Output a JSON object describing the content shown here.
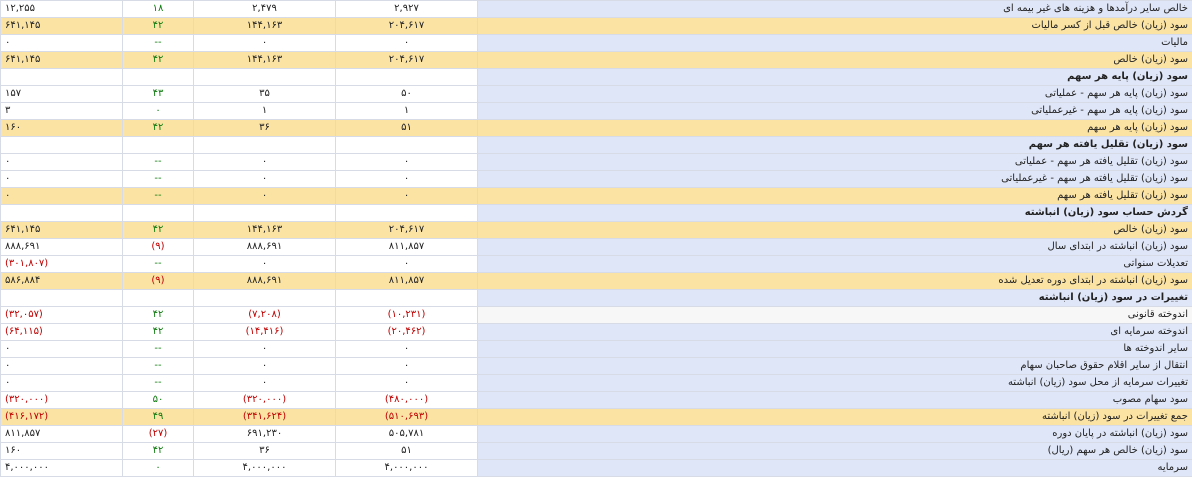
{
  "rows": [
    {
      "label": "خالص سایر درآمدها و هزینه های غیر بیمه ای",
      "v1": "۲,۹۲۷",
      "v2": "۲,۴۷۹",
      "v3": "۱۸",
      "v3c": "pos",
      "v4": "۱۲,۲۵۵",
      "style": ""
    },
    {
      "label": "سود (زیان) خالص قبل از کسر مالیات",
      "v1": "۲۰۴,۶۱۷",
      "v2": "۱۴۴,۱۶۳",
      "v3": "۴۲",
      "v3c": "pos",
      "v4": "۶۴۱,۱۴۵",
      "style": "gold"
    },
    {
      "label": "مالیات",
      "v1": "۰",
      "v2": "۰",
      "v3": "--",
      "v3c": "pos",
      "v4": "۰",
      "style": ""
    },
    {
      "label": "سود (زیان) خالص",
      "v1": "۲۰۴,۶۱۷",
      "v2": "۱۴۴,۱۶۳",
      "v3": "۴۲",
      "v3c": "pos",
      "v4": "۶۴۱,۱۴۵",
      "style": "gold"
    },
    {
      "label": "سود (زیان) پایه هر سهم",
      "v1": "",
      "v2": "",
      "v3": "",
      "v3c": "",
      "v4": "",
      "style": "header"
    },
    {
      "label": "سود (زیان) پایه هر سهم - عملیاتی",
      "v1": "۵۰",
      "v2": "۳۵",
      "v3": "۴۳",
      "v3c": "pos",
      "v4": "۱۵۷",
      "style": ""
    },
    {
      "label": "سود (زیان) پایه هر سهم - غیرعملیاتی",
      "v1": "۱",
      "v2": "۱",
      "v3": "۰",
      "v3c": "pos",
      "v4": "۳",
      "style": ""
    },
    {
      "label": "سود (زیان) پایه هر سهم",
      "v1": "۵۱",
      "v2": "۳۶",
      "v3": "۴۲",
      "v3c": "pos",
      "v4": "۱۶۰",
      "style": "gold"
    },
    {
      "label": "سود (زیان) تقلیل یافته هر سهم",
      "v1": "",
      "v2": "",
      "v3": "",
      "v3c": "",
      "v4": "",
      "style": "header"
    },
    {
      "label": "سود (زیان) تقلیل یافته هر سهم - عملیاتی",
      "v1": "۰",
      "v2": "۰",
      "v3": "--",
      "v3c": "pos",
      "v4": "۰",
      "style": ""
    },
    {
      "label": "سود (زیان) تقلیل یافته هر سهم - غیرعملیاتی",
      "v1": "۰",
      "v2": "۰",
      "v3": "--",
      "v3c": "pos",
      "v4": "۰",
      "style": ""
    },
    {
      "label": "سود (زیان) تقلیل یافته هر سهم",
      "v1": "۰",
      "v2": "۰",
      "v3": "--",
      "v3c": "pos",
      "v4": "۰",
      "style": "gold"
    },
    {
      "label": "گردش حساب سود (زیان) انباشته",
      "v1": "",
      "v2": "",
      "v3": "",
      "v3c": "",
      "v4": "",
      "style": "header"
    },
    {
      "label": "سود (زیان) خالص",
      "v1": "۲۰۴,۶۱۷",
      "v2": "۱۴۴,۱۶۳",
      "v3": "۴۲",
      "v3c": "pos",
      "v4": "۶۴۱,۱۴۵",
      "style": "gold"
    },
    {
      "label": "سود (زیان) انباشته در ابتدای سال",
      "v1": "۸۱۱,۸۵۷",
      "v2": "۸۸۸,۶۹۱",
      "v3": "(۹)",
      "v3c": "neg",
      "v4": "۸۸۸,۶۹۱",
      "style": ""
    },
    {
      "label": "تعدیلات سنواتی",
      "v1": "۰",
      "v2": "۰",
      "v3": "--",
      "v3c": "pos",
      "v4": "(۳۰۱,۸۰۷)",
      "v4c": "neg",
      "style": ""
    },
    {
      "label": "سود (زیان) انباشته در ابتدای دوره تعدیل شده",
      "v1": "۸۱۱,۸۵۷",
      "v2": "۸۸۸,۶۹۱",
      "v3": "(۹)",
      "v3c": "neg",
      "v4": "۵۸۶,۸۸۴",
      "style": "gold"
    },
    {
      "label": "تغییرات در سود (زیان) انباشته",
      "v1": "",
      "v2": "",
      "v3": "",
      "v3c": "",
      "v4": "",
      "style": "header"
    },
    {
      "label": "اندوخته قانونی",
      "v1": "(۱۰,۲۳۱)",
      "v1c": "neg",
      "v2": "(۷,۲۰۸)",
      "v2c": "neg",
      "v3": "۴۲",
      "v3c": "pos",
      "v4": "(۳۲,۰۵۷)",
      "v4c": "neg",
      "style": "hl"
    },
    {
      "label": "اندوخته سرمایه ای",
      "v1": "(۲۰,۴۶۲)",
      "v1c": "neg",
      "v2": "(۱۴,۴۱۶)",
      "v2c": "neg",
      "v3": "۴۲",
      "v3c": "pos",
      "v4": "(۶۴,۱۱۵)",
      "v4c": "neg",
      "style": ""
    },
    {
      "label": "سایر اندوخته ها",
      "v1": "۰",
      "v2": "۰",
      "v3": "--",
      "v3c": "pos",
      "v4": "۰",
      "style": ""
    },
    {
      "label": "انتقال از سایر اقلام حقوق صاحبان سهام",
      "v1": "۰",
      "v2": "۰",
      "v3": "--",
      "v3c": "pos",
      "v4": "۰",
      "style": ""
    },
    {
      "label": "تغییرات سرمایه از محل سود (زیان) انباشته",
      "v1": "۰",
      "v2": "۰",
      "v3": "--",
      "v3c": "pos",
      "v4": "۰",
      "style": ""
    },
    {
      "label": "سود سهام مصوب",
      "v1": "(۴۸۰,۰۰۰)",
      "v1c": "neg",
      "v2": "(۳۲۰,۰۰۰)",
      "v2c": "neg",
      "v3": "۵۰",
      "v3c": "pos",
      "v4": "(۳۲۰,۰۰۰)",
      "v4c": "neg",
      "style": ""
    },
    {
      "label": "جمع تغییرات در سود (زیان) انباشته",
      "v1": "(۵۱۰,۶۹۳)",
      "v1c": "neg",
      "v2": "(۳۴۱,۶۲۴)",
      "v2c": "neg",
      "v3": "۴۹",
      "v3c": "pos",
      "v4": "(۴۱۶,۱۷۲)",
      "v4c": "neg",
      "style": "gold"
    },
    {
      "label": "سود (زیان) انباشته در پایان دوره",
      "v1": "۵۰۵,۷۸۱",
      "v2": "۶۹۱,۲۳۰",
      "v3": "(۲۷)",
      "v3c": "neg",
      "v4": "۸۱۱,۸۵۷",
      "style": ""
    },
    {
      "label": "سود (زیان) خالص هر سهم (ریال)",
      "v1": "۵۱",
      "v2": "۳۶",
      "v3": "۴۲",
      "v3c": "pos",
      "v4": "۱۶۰",
      "style": ""
    },
    {
      "label": "سرمایه",
      "v1": "۴,۰۰۰,۰۰۰",
      "v2": "۴,۰۰۰,۰۰۰",
      "v3": "۰",
      "v3c": "pos",
      "v4": "۴,۰۰۰,۰۰۰",
      "style": ""
    }
  ]
}
